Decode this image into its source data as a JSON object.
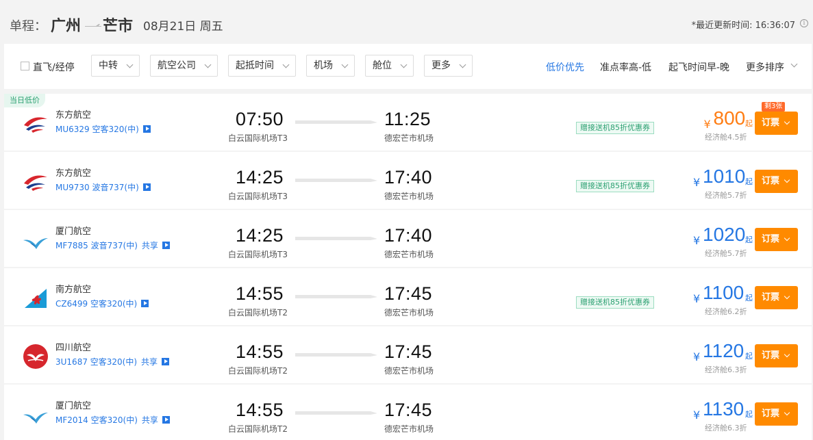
{
  "header": {
    "trip_type": "单程：",
    "from_city": "广州",
    "to_city": "芒市",
    "date": "08月21日 周五",
    "updated": "*最近更新时间: 16:36:07",
    "info_icon": "i"
  },
  "filters": {
    "direct_label": "直飞/经停",
    "dropdowns": [
      "中转",
      "航空公司",
      "起抵时间",
      "机场",
      "舱位",
      "更多"
    ],
    "sorts": [
      "低价优先",
      "准点率高-低",
      "起飞时间早-晚",
      "更多排序"
    ]
  },
  "icons": {
    "info": "info-circle-icon",
    "play": "play-icon",
    "chevron": "chevron-down-icon"
  },
  "colors": {
    "accent_blue": "#2577e3",
    "book_orange": "#ff8a00",
    "price_orange": "#ff7d13",
    "coupon_green": "#2ba071"
  },
  "flights": [
    {
      "badge": "当日低价",
      "airline": "东方航空",
      "logo": "china-eastern-logo",
      "flight": "MU6329 空客320(中)",
      "share": "",
      "dep_time": "07:50",
      "dep_airport": "白云国际机场T3",
      "arr_time": "11:25",
      "arr_airport": "德宏芒市机场",
      "coupon": "赠接送机85折优惠券",
      "currency": "¥",
      "price": "800",
      "price_suffix": "起",
      "cabin": "经济舱4.5折",
      "remaining": "剩3张",
      "book": "订票"
    },
    {
      "badge": "",
      "airline": "东方航空",
      "logo": "china-eastern-logo",
      "flight": "MU9730 波音737(中)",
      "share": "",
      "dep_time": "14:25",
      "dep_airport": "白云国际机场T3",
      "arr_time": "17:40",
      "arr_airport": "德宏芒市机场",
      "coupon": "赠接送机85折优惠券",
      "currency": "¥",
      "price": "1010",
      "price_suffix": "起",
      "cabin": "经济舱5.7折",
      "remaining": "",
      "book": "订票"
    },
    {
      "badge": "",
      "airline": "厦门航空",
      "logo": "xiamen-airlines-logo",
      "flight": "MF7885 波音737(中)",
      "share": "共享",
      "dep_time": "14:25",
      "dep_airport": "白云国际机场T3",
      "arr_time": "17:40",
      "arr_airport": "德宏芒市机场",
      "coupon": "",
      "currency": "¥",
      "price": "1020",
      "price_suffix": "起",
      "cabin": "经济舱5.7折",
      "remaining": "",
      "book": "订票"
    },
    {
      "badge": "",
      "airline": "南方航空",
      "logo": "china-southern-logo",
      "flight": "CZ6499 空客320(中)",
      "share": "",
      "dep_time": "14:55",
      "dep_airport": "白云国际机场T2",
      "arr_time": "17:45",
      "arr_airport": "德宏芒市机场",
      "coupon": "赠接送机85折优惠券",
      "currency": "¥",
      "price": "1100",
      "price_suffix": "起",
      "cabin": "经济舱6.2折",
      "remaining": "",
      "book": "订票"
    },
    {
      "badge": "",
      "airline": "四川航空",
      "logo": "sichuan-airlines-logo",
      "flight": "3U1687 空客320(中)",
      "share": "共享",
      "dep_time": "14:55",
      "dep_airport": "白云国际机场T2",
      "arr_time": "17:45",
      "arr_airport": "德宏芒市机场",
      "coupon": "",
      "currency": "¥",
      "price": "1120",
      "price_suffix": "起",
      "cabin": "经济舱6.3折",
      "remaining": "",
      "book": "订票"
    },
    {
      "badge": "",
      "airline": "厦门航空",
      "logo": "xiamen-airlines-logo",
      "flight": "MF2014 空客320(中)",
      "share": "共享",
      "dep_time": "14:55",
      "dep_airport": "白云国际机场T2",
      "arr_time": "17:45",
      "arr_airport": "德宏芒市机场",
      "coupon": "",
      "currency": "¥",
      "price": "1130",
      "price_suffix": "起",
      "cabin": "经济舱6.3折",
      "remaining": "",
      "book": "订票"
    }
  ]
}
